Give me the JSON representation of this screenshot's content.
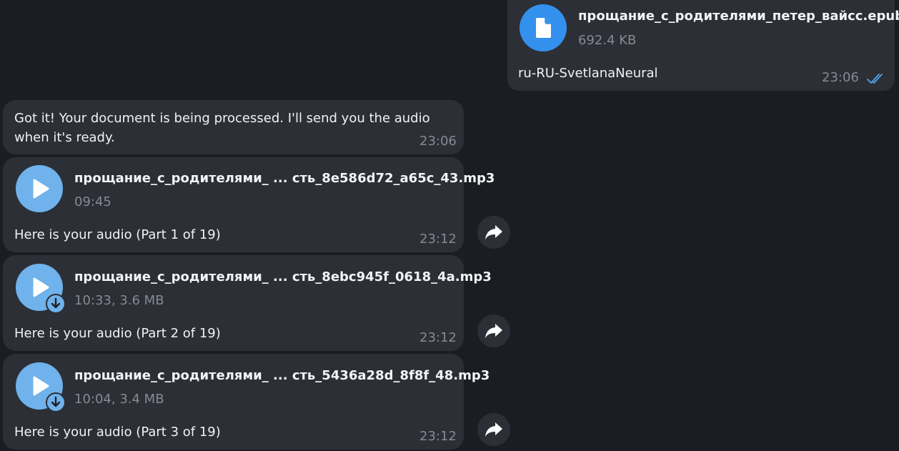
{
  "outgoing": {
    "file_name": "прощание_с_родителями_петер_вайсс.epub",
    "file_size": "692.4 KB",
    "caption": "ru-RU-SvetlanaNeural",
    "time": "23:06",
    "status": "read"
  },
  "incoming_text": {
    "line1": "Got it! Your document is being processed. I'll send you the audio",
    "line2": "when it's ready.",
    "time": "23:06"
  },
  "audio_messages": [
    {
      "file_name": "прощание_с_родителями_ ... сть_8e586d72_a65c_43.mp3",
      "meta": "09:45",
      "caption": "Here is your audio (Part 1 of 19)",
      "time": "23:12"
    },
    {
      "file_name": "прощание_с_родителями_ ... сть_8ebc945f_0618_4a.mp3",
      "meta": "10:33, 3.6 MB",
      "caption": "Here is your audio (Part 2 of 19)",
      "time": "23:12"
    },
    {
      "file_name": "прощание_с_родителями_ ... сть_5436a28d_8f8f_48.mp3",
      "meta": "10:04, 3.4 MB",
      "caption": "Here is your audio (Part 3 of 19)",
      "time": "23:12"
    }
  ],
  "colors": {
    "background": "#1c1d22",
    "bubble": "#2c2f35",
    "accent_blue": "#3390ec",
    "audio_blue": "#6fb2ec",
    "muted_text": "#858a92"
  },
  "icons": {
    "document": "document-icon",
    "play": "play-icon",
    "download": "download-arrow-icon",
    "forward": "forward-arrow-icon",
    "read_receipt": "double-check-icon"
  }
}
